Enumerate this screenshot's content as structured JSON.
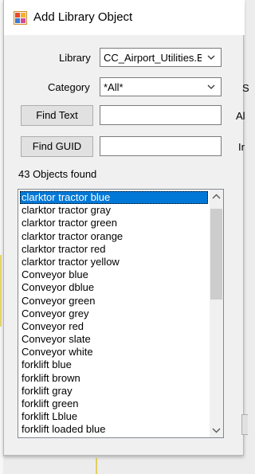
{
  "window": {
    "title": "Add Library Object",
    "icon": "library-object-icon"
  },
  "library": {
    "label": "Library",
    "value": "CC_Airport_Utilities.B"
  },
  "category": {
    "label": "Category",
    "value": "*All*"
  },
  "find_text": {
    "label": "Find Text",
    "value": ""
  },
  "find_guid": {
    "label": "Find GUID",
    "value": ""
  },
  "results": {
    "count_text": "43 Objects found"
  },
  "objects": [
    "clarktor tractor blue",
    "clarktor tractor gray",
    "clarktor tractor green",
    "clarktor tractor orange",
    "clarktor tractor red",
    "clarktor tractor yellow",
    "Conveyor blue",
    "Conveyor dblue",
    "Conveyor green",
    "Conveyor grey",
    "Conveyor red",
    "Conveyor slate",
    "Conveyor white",
    "forklift blue",
    "forklift brown",
    "forklift gray",
    "forklift green",
    "forklift Lblue",
    "forklift loaded blue"
  ],
  "selected_index": 0,
  "right_cutoff": {
    "row2": "S",
    "row3": "Al",
    "row4": "Ir"
  },
  "colors": {
    "selection": "#0078d7",
    "dialog_bg": "#f0f0f0",
    "button_bg": "#e1e1e1"
  }
}
